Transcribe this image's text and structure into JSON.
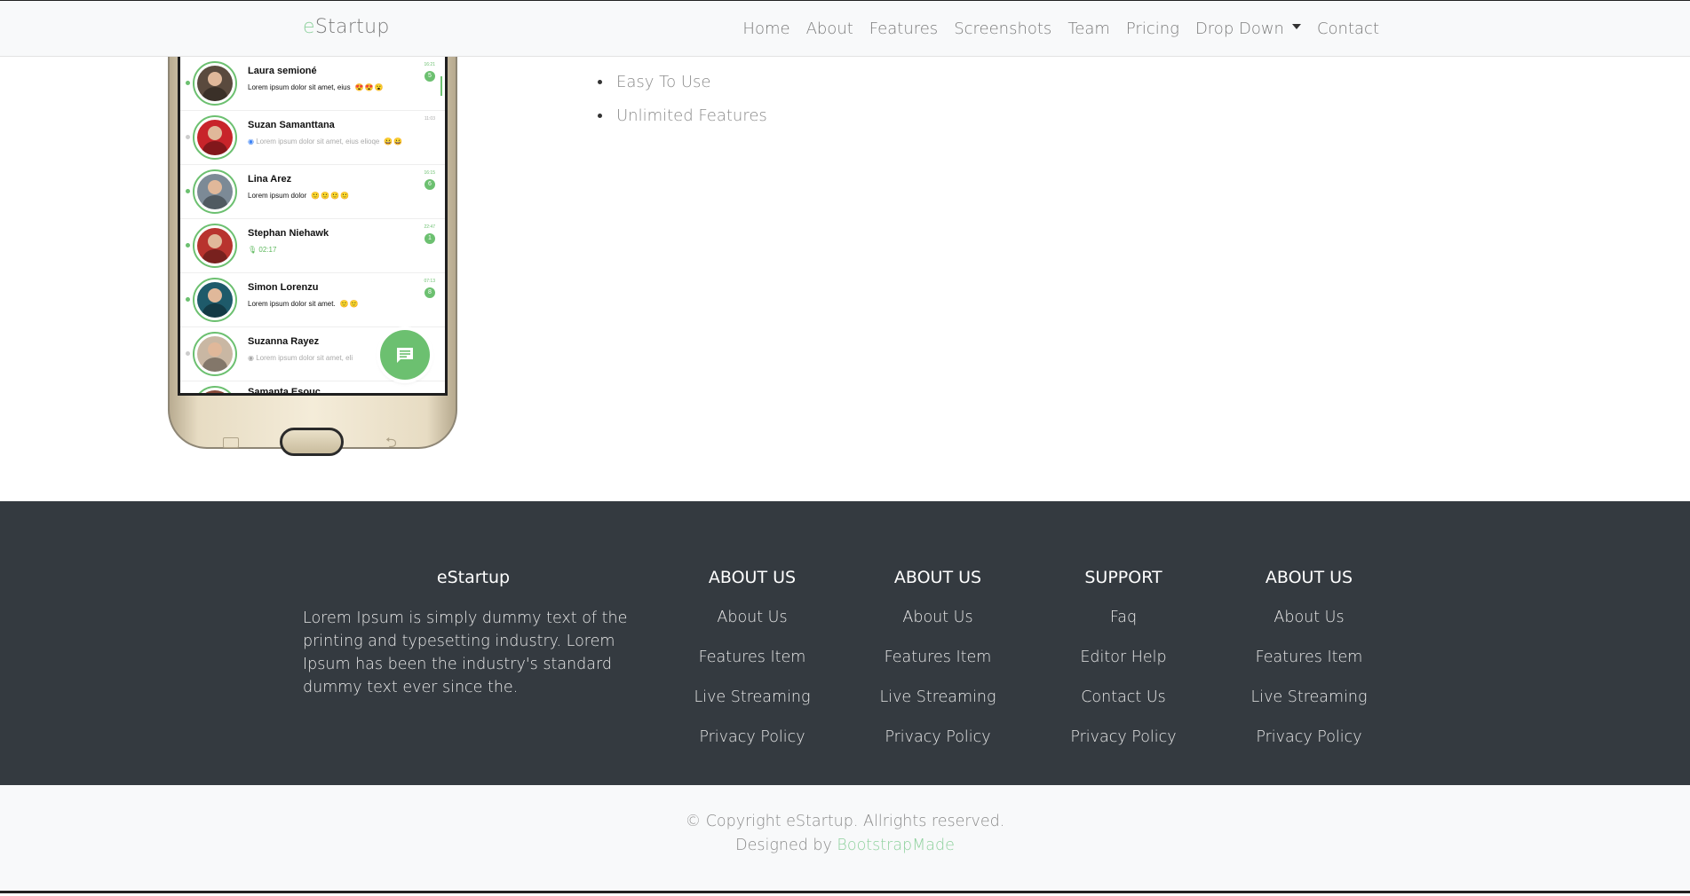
{
  "navbar": {
    "brand_first": "e",
    "brand_rest": "Startup",
    "links": [
      "Home",
      "About",
      "Features",
      "Screenshots",
      "Team",
      "Pricing",
      "Drop Down",
      "Contact"
    ]
  },
  "phone": {
    "chats": [
      {
        "name": "Laura semioné",
        "message": "Lorem ipsum dolor sit amet, eius",
        "emoji": "😍😍😮",
        "time": "16:21",
        "badge": "5"
      },
      {
        "name": "Suzan Samanttana",
        "message": "Lorem ipsum dolor sit amet, eius elioqe",
        "emoji": "😀😀",
        "time": "11:03",
        "badge": ""
      },
      {
        "name": "Lina Arez",
        "message": "Lorem ipsum dolor",
        "emoji": "🙂🙂🙂🙂",
        "time": "16:15",
        "badge": "6"
      },
      {
        "name": "Stephan Niehawk",
        "message": "02:17",
        "emoji": "",
        "time": "22:47",
        "badge": "1"
      },
      {
        "name": "Simon Lorenzu",
        "message": "Lorem ipsum dolor sit amet.",
        "emoji": "🙂🙂",
        "time": "07:13",
        "badge": "8"
      },
      {
        "name": "Suzanna Rayez",
        "message": "Lorem ipsum dolor sit amet, eli",
        "emoji": "",
        "time": "",
        "badge": ""
      },
      {
        "name": "Samanta Esouc",
        "message": "",
        "emoji": "",
        "time": "",
        "badge": ""
      }
    ]
  },
  "features": [
    "Easy To Use",
    "Unlimited Features"
  ],
  "footer": {
    "about": {
      "title": "eStartup",
      "text": "Lorem Ipsum is simply dummy text of the printing and typesetting industry. Lorem Ipsum has been the industry's standard dummy text ever since the."
    },
    "columns": [
      {
        "title": "ABOUT US",
        "links": [
          "About Us",
          "Features Item",
          "Live Streaming",
          "Privacy Policy"
        ]
      },
      {
        "title": "ABOUT US",
        "links": [
          "About Us",
          "Features Item",
          "Live Streaming",
          "Privacy Policy"
        ]
      },
      {
        "title": "SUPPORT",
        "links": [
          "Faq",
          "Editor Help",
          "Contact Us",
          "Privacy Policy"
        ]
      },
      {
        "title": "ABOUT US",
        "links": [
          "About Us",
          "Features Item",
          "Live Streaming",
          "Privacy Policy"
        ]
      }
    ]
  },
  "copyright": {
    "line1": "© Copyright eStartup. Allrights reserved.",
    "designed_prefix": "Designed by ",
    "designed_link": "BootstrapMade"
  },
  "colors": {
    "accent": "#8fd19e",
    "chat_green": "#6cc070",
    "footer_bg": "#343a40",
    "navbar_bg": "#f8f9fa"
  }
}
